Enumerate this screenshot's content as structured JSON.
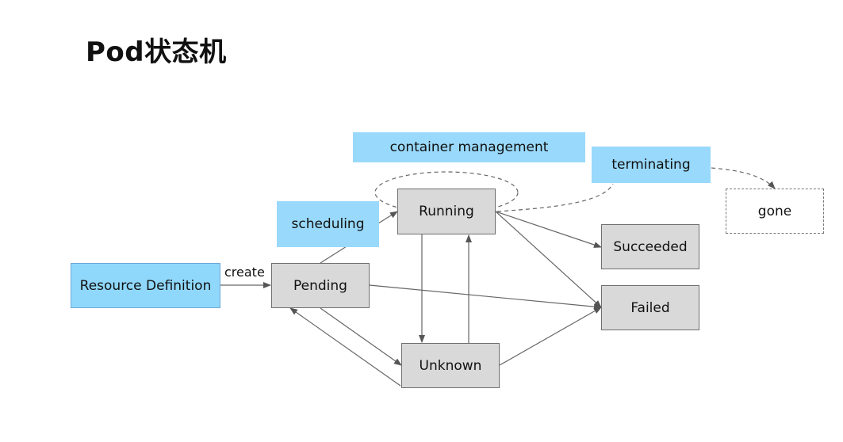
{
  "title": "Pod状态机",
  "nodes": {
    "resource_definition": "Resource Definition",
    "pending": "Pending",
    "running": "Running",
    "unknown": "Unknown",
    "succeeded": "Succeeded",
    "failed": "Failed",
    "gone": "gone"
  },
  "tags": {
    "scheduling": "scheduling",
    "container_management": "container management",
    "terminating": "terminating"
  },
  "edge_labels": {
    "create": "create"
  }
}
